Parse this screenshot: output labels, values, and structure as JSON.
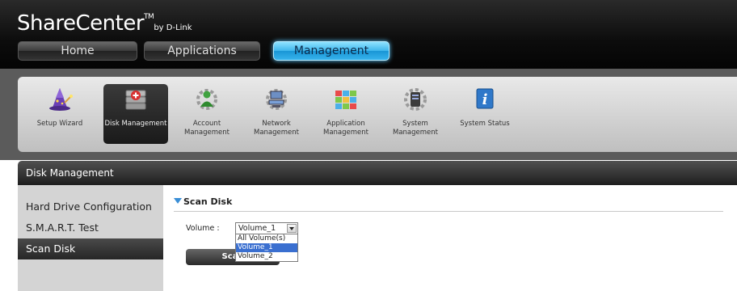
{
  "app": {
    "brand": "ShareCenter",
    "trademark": "TM",
    "byline": "by D-Link"
  },
  "nav": [
    {
      "label": "Home",
      "active": false
    },
    {
      "label": "Applications",
      "active": false
    },
    {
      "label": "Management",
      "active": true
    }
  ],
  "toolbar": [
    {
      "label": "Setup Wizard",
      "icon": "wizard-icon",
      "selected": false
    },
    {
      "label": "Disk Management",
      "icon": "disk-management-icon",
      "selected": true
    },
    {
      "label": "Account Management",
      "icon": "account-management-icon",
      "selected": false
    },
    {
      "label": "Network Management",
      "icon": "network-management-icon",
      "selected": false
    },
    {
      "label": "Application Management",
      "icon": "application-management-icon",
      "selected": false
    },
    {
      "label": "System Management",
      "icon": "system-management-icon",
      "selected": false
    },
    {
      "label": "System Status",
      "icon": "info-icon",
      "selected": false
    }
  ],
  "panel": {
    "title": "Disk Management"
  },
  "sidebar": {
    "items": [
      {
        "label": "Hard Drive Configuration",
        "selected": false
      },
      {
        "label": "S.M.A.R.T. Test",
        "selected": false
      },
      {
        "label": "Scan Disk",
        "selected": true
      }
    ]
  },
  "scan_disk": {
    "section_title": "Scan Disk",
    "volume_label": "Volume :",
    "volume_selected": "Volume_1",
    "options": [
      "All Volume(s)",
      "Volume_1",
      "Volume_2"
    ],
    "highlighted_option": "Volume_1",
    "scan_button": "Scan"
  },
  "colors": {
    "accent": "#37b3ec",
    "header_bg": "#0c0c0c",
    "sidebar_bg": "#d4d4d4",
    "selection": "#3a6fd0"
  }
}
